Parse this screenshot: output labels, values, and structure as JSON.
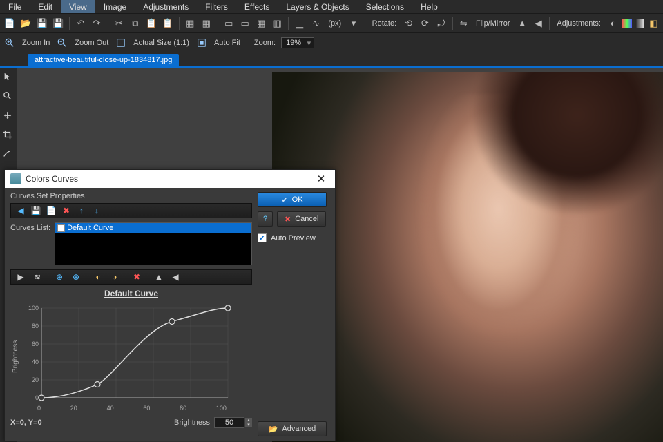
{
  "menu": [
    "File",
    "Edit",
    "View",
    "Image",
    "Adjustments",
    "Filters",
    "Effects",
    "Layers & Objects",
    "Selections",
    "Help"
  ],
  "menu_active_index": 2,
  "toolbar1": {
    "rotate_label": "Rotate:",
    "flip_label": "Flip/Mirror",
    "adjust_label": "Adjustments:",
    "px_label": "(px)"
  },
  "toolbar2": {
    "zoom_in": "Zoom In",
    "zoom_out": "Zoom Out",
    "actual_size": "Actual Size (1:1)",
    "auto_fit": "Auto Fit",
    "zoom_label": "Zoom:",
    "zoom_value": "19%"
  },
  "tab": {
    "filename": "attractive-beautiful-close-up-1834817.jpg"
  },
  "dialog": {
    "title": "Colors Curves",
    "section": "Curves Set Properties",
    "curves_list_label": "Curves List:",
    "selected_curve": "Default Curve",
    "curve_title": "Default Curve",
    "ylabel": "Brightness",
    "xlabel": "Brightness",
    "coord": "X=0, Y=0",
    "num_value": "50",
    "ok": "OK",
    "cancel": "Cancel",
    "auto_preview": "Auto Preview",
    "advanced": "Advanced"
  },
  "chart_data": {
    "type": "line",
    "title": "Default Curve",
    "xlabel": "Brightness",
    "ylabel": "Brightness",
    "xlim": [
      0,
      100
    ],
    "ylim": [
      0,
      100
    ],
    "x_ticks": [
      0,
      20,
      40,
      60,
      80,
      100
    ],
    "y_ticks": [
      0,
      20,
      40,
      60,
      80,
      100
    ],
    "series": [
      {
        "name": "Default Curve",
        "x": [
          0,
          30,
          70,
          100
        ],
        "y": [
          0,
          15,
          85,
          100
        ]
      }
    ]
  }
}
